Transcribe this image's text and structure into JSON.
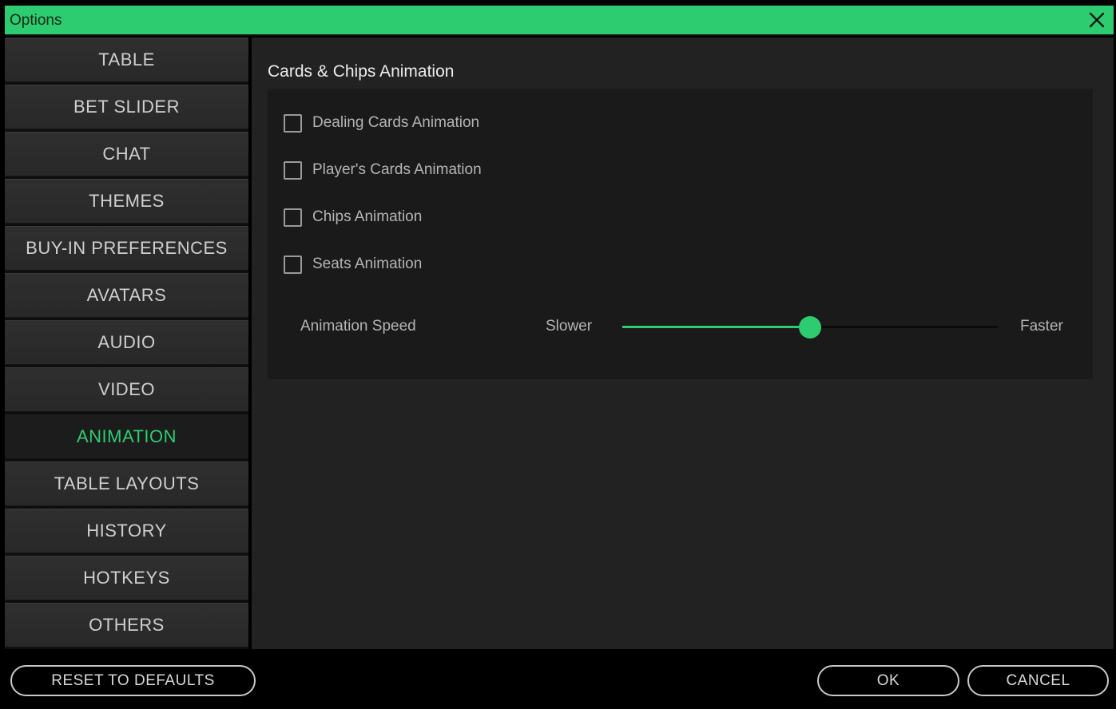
{
  "window": {
    "title": "Options"
  },
  "sidebar": {
    "items": [
      {
        "label": "TABLE"
      },
      {
        "label": "BET SLIDER"
      },
      {
        "label": "CHAT"
      },
      {
        "label": "THEMES"
      },
      {
        "label": "BUY-IN PREFERENCES"
      },
      {
        "label": "AVATARS"
      },
      {
        "label": "AUDIO"
      },
      {
        "label": "VIDEO"
      },
      {
        "label": "ANIMATION",
        "active": true
      },
      {
        "label": "TABLE LAYOUTS"
      },
      {
        "label": "HISTORY"
      },
      {
        "label": "HOTKEYS"
      },
      {
        "label": "OTHERS"
      }
    ]
  },
  "main": {
    "section_title": "Cards & Chips Animation",
    "options": [
      {
        "label": "Dealing Cards Animation",
        "checked": false
      },
      {
        "label": "Player's Cards Animation",
        "checked": false
      },
      {
        "label": "Chips Animation",
        "checked": false
      },
      {
        "label": "Seats Animation",
        "checked": false
      }
    ],
    "speed": {
      "label": "Animation Speed",
      "min_label": "Slower",
      "max_label": "Faster",
      "value_fraction": 0.5
    }
  },
  "footer": {
    "reset_label": "RESET TO DEFAULTS",
    "ok_label": "OK",
    "cancel_label": "CANCEL"
  },
  "colors": {
    "accent": "#2ecc71",
    "panel": "#1a1a1a",
    "background": "#222222"
  },
  "icons": {
    "close": "close-icon"
  }
}
